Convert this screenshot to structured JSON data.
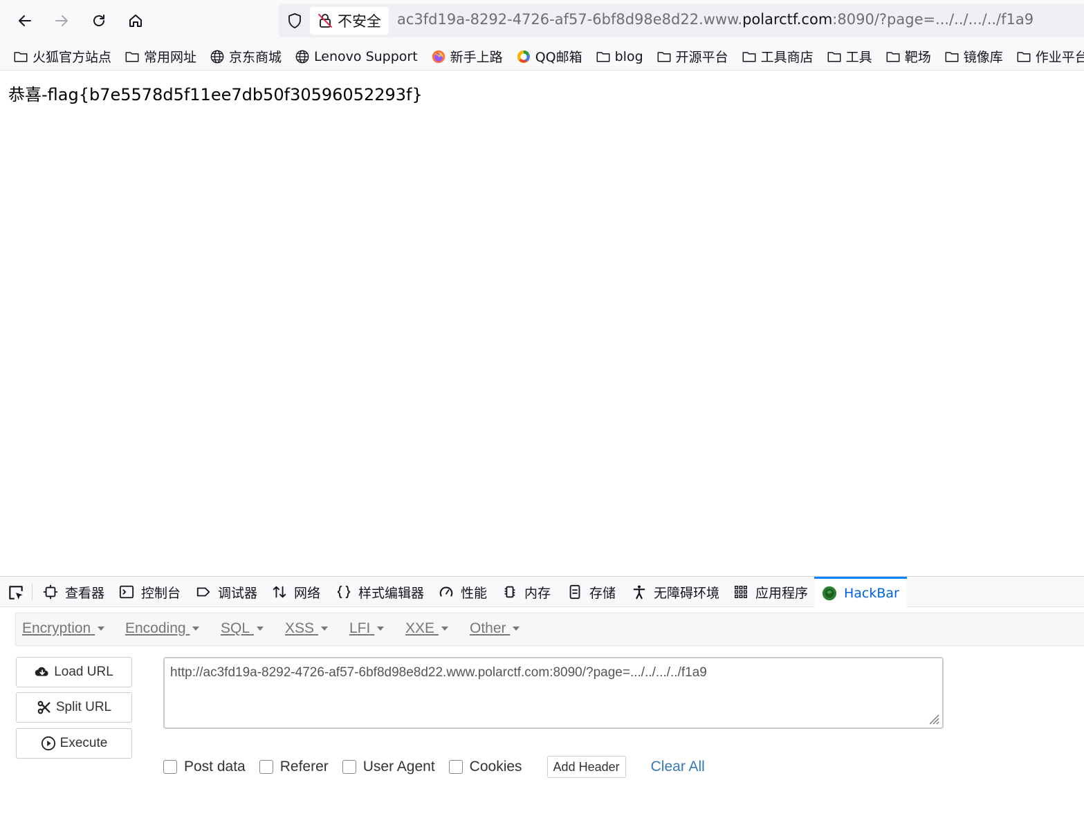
{
  "toolbar": {
    "insecure_label": "不安全",
    "url_prefix": "ac3fd19a-8292-4726-af57-6bf8d98e8d22.www.",
    "url_domain": "polarctf.com",
    "url_suffix": ":8090/?page=.../../.../../f1a9"
  },
  "bookmarks": [
    {
      "label": "火狐官方站点",
      "icon": "folder-icon"
    },
    {
      "label": "常用网址",
      "icon": "folder-icon"
    },
    {
      "label": "京东商城",
      "icon": "globe-icon"
    },
    {
      "label": "Lenovo Support",
      "icon": "globe-icon"
    },
    {
      "label": "新手上路",
      "icon": "firefox-icon"
    },
    {
      "label": "QQ邮箱",
      "icon": "qq-mail-icon"
    },
    {
      "label": "blog",
      "icon": "folder-icon"
    },
    {
      "label": "开源平台",
      "icon": "folder-icon"
    },
    {
      "label": "工具商店",
      "icon": "folder-icon"
    },
    {
      "label": "工具",
      "icon": "folder-icon"
    },
    {
      "label": "靶场",
      "icon": "folder-icon"
    },
    {
      "label": "镜像库",
      "icon": "folder-icon"
    },
    {
      "label": "作业平台",
      "icon": "folder-icon"
    }
  ],
  "page": {
    "content_text": "恭喜-flag{b7e5578d5f11ee7db50f30596052293f}"
  },
  "devtools": {
    "tabs": [
      {
        "label": "查看器",
        "icon": "inspector-icon"
      },
      {
        "label": "控制台",
        "icon": "console-icon"
      },
      {
        "label": "调试器",
        "icon": "debugger-icon"
      },
      {
        "label": "网络",
        "icon": "network-icon"
      },
      {
        "label": "样式编辑器",
        "icon": "style-editor-icon"
      },
      {
        "label": "性能",
        "icon": "performance-icon"
      },
      {
        "label": "内存",
        "icon": "memory-icon"
      },
      {
        "label": "存储",
        "icon": "storage-icon"
      },
      {
        "label": "无障碍环境",
        "icon": "accessibility-icon"
      },
      {
        "label": "应用程序",
        "icon": "application-icon"
      },
      {
        "label": "HackBar",
        "icon": "hackbar-icon",
        "active": true
      }
    ]
  },
  "hackbar": {
    "menu": [
      "Encryption",
      "Encoding",
      "SQL",
      "XSS",
      "LFI",
      "XXE",
      "Other"
    ],
    "load_url": "Load URL",
    "split_url": "Split URL",
    "execute": "Execute",
    "url_value": "http://ac3fd19a-8292-4726-af57-6bf8d98e8d22.www.polarctf.com:8090/?page=.../../.../../f1a9",
    "options": [
      "Post data",
      "Referer",
      "User Agent",
      "Cookies"
    ],
    "add_header": "Add Header",
    "clear_all": "Clear All"
  },
  "colors": {
    "active_tab": "#0061e0",
    "link": "#337ab7"
  }
}
